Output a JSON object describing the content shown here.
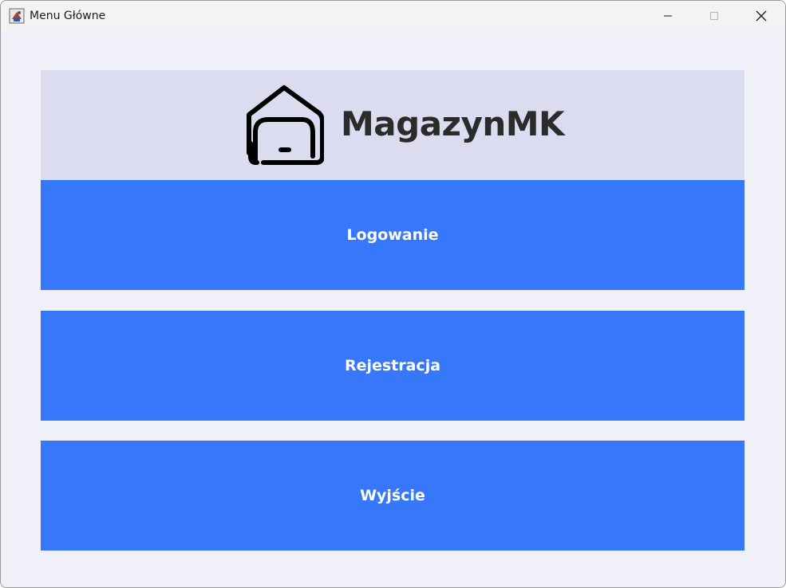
{
  "window": {
    "title": "Menu Główne"
  },
  "header": {
    "brand": "MagazynMK",
    "logo_icon": "warehouse-icon"
  },
  "menu": {
    "login_label": "Logowanie",
    "register_label": "Rejestracja",
    "exit_label": "Wyjście"
  },
  "colors": {
    "button_bg": "#3778fa",
    "header_bg": "#dcdcf0",
    "content_bg": "#eff0f8"
  }
}
